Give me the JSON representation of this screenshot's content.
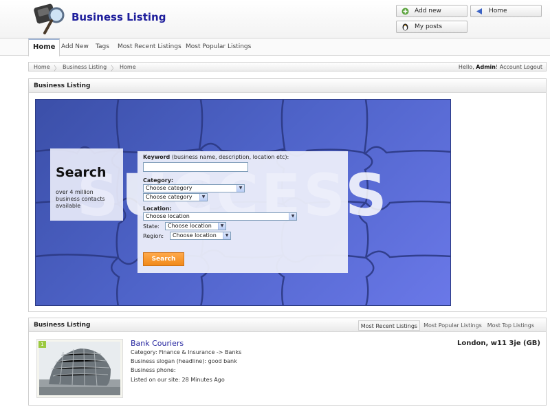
{
  "header": {
    "title": "Business Listing",
    "buttons": {
      "add_new": "Add new",
      "home": "Home",
      "my_posts": "My posts"
    }
  },
  "nav": {
    "items": [
      "Home",
      "Add New",
      "Tags",
      "Most Recent Listings",
      "Most Popular Listings"
    ]
  },
  "breadcrumb": {
    "items": [
      "Home",
      "Business Listing",
      "Home"
    ],
    "greeting": "Hello,",
    "user": "Admin",
    "account_link": "! Account",
    "logout": "Logout"
  },
  "search_panel": {
    "heading": "Business Listing",
    "banner_word": "SUCCESS",
    "search_title": "Search",
    "search_sub": "over 4 million business contacts available",
    "keyword_label": "Keyword",
    "keyword_hint": "(business name, description, location etc):",
    "keyword_value": "",
    "category_label": "Category:",
    "category_select_1": "Choose category",
    "category_select_2": "Choose category",
    "location_label": "Location:",
    "location_select": "Choose location",
    "state_label": "State:",
    "state_select": "Choose location",
    "region_label": "Region:",
    "region_select": "Choose location",
    "search_button": "Search"
  },
  "listing_panel": {
    "heading": "Business Listing",
    "tabs": [
      "Most Recent Listings",
      "Most Popular Listings",
      "Most Top Listings"
    ],
    "active_tab": "Most Recent Listings",
    "items": [
      {
        "rank": "1",
        "title": "Bank Couriers",
        "category": "Category: Finance & Insurance -> Banks",
        "slogan": "Business slogan (headline): good bank",
        "phone": "Business phone:",
        "listed": "Listed on our site: 28 Minutes Ago",
        "location": "London, w11 3je (GB)"
      }
    ]
  },
  "colors": {
    "title": "#1e1e9c",
    "banner": "#4e63c8",
    "search_button": "#f08a1a",
    "rank_badge": "#9bc940"
  }
}
